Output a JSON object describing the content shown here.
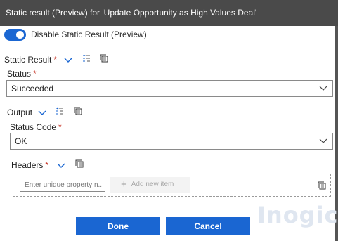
{
  "dialog": {
    "title": "Static result (Preview) for 'Update Opportunity as High Values Deal'"
  },
  "toggle": {
    "label": "Disable Static Result (Preview)",
    "state": "on"
  },
  "static_result": {
    "label": "Static Result",
    "required_mark": "*"
  },
  "status": {
    "label": "Status",
    "required_mark": "*",
    "value": "Succeeded"
  },
  "output": {
    "label": "Output"
  },
  "status_code": {
    "label": "Status Code",
    "required_mark": "*",
    "value": "OK"
  },
  "headers": {
    "label": "Headers",
    "required_mark": "*",
    "property_placeholder": "Enter unique property n...",
    "add_item_label": "Add new item"
  },
  "buttons": {
    "done": "Done",
    "cancel": "Cancel"
  },
  "watermark": "Inogic",
  "colors": {
    "accent": "#1a66d2",
    "titlebar": "#4a4a4a",
    "required": "#c42b1c"
  }
}
